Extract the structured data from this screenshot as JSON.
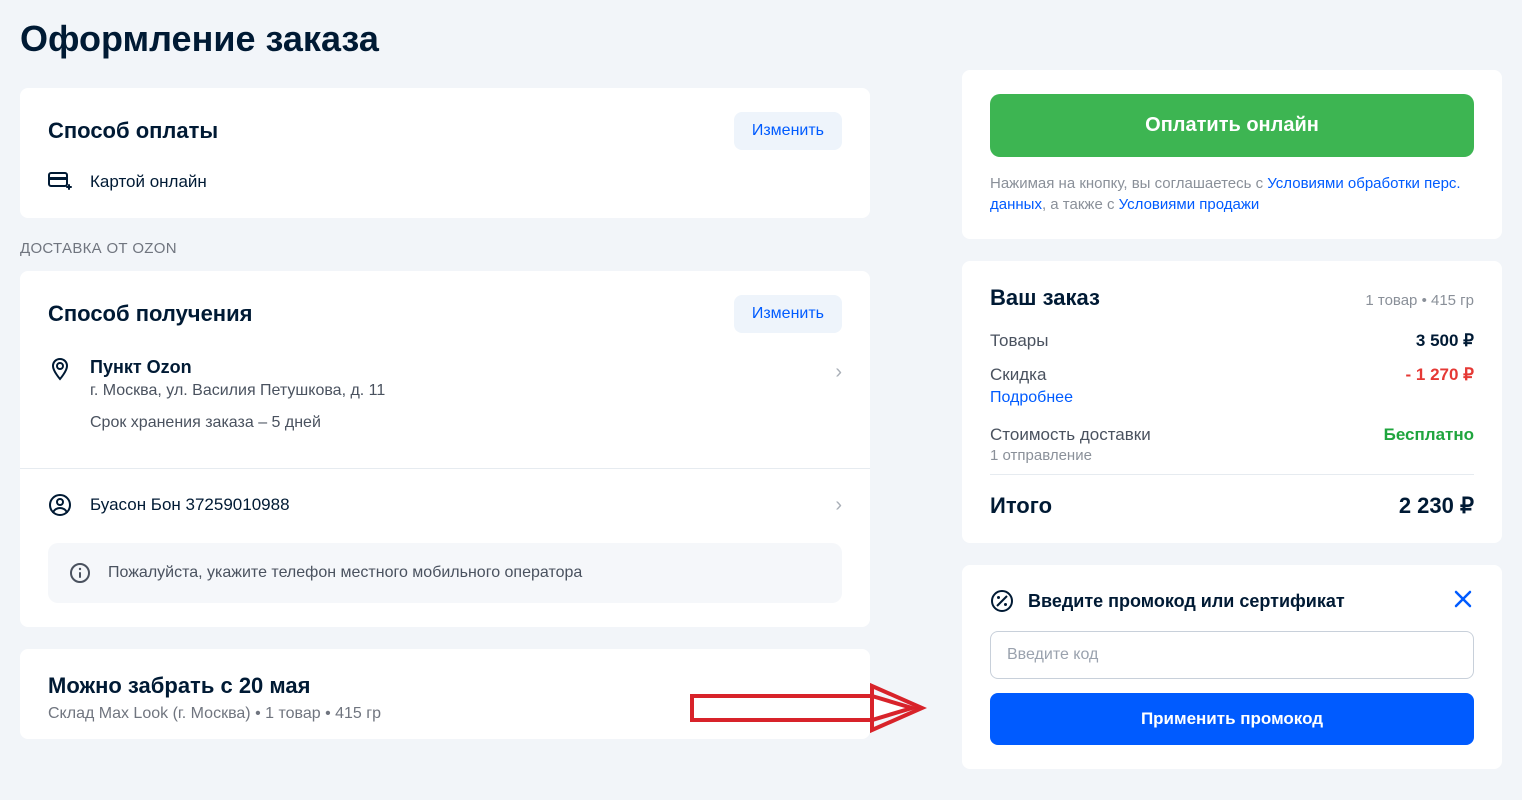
{
  "page": {
    "title": "Оформление заказа"
  },
  "payment": {
    "section_title": "Способ оплаты",
    "change_label": "Изменить",
    "method_label": "Картой онлайн"
  },
  "delivery": {
    "group_label": "ДОСТАВКА ОТ OZON",
    "section_title": "Способ получения",
    "change_label": "Изменить",
    "point_title": "Пункт Ozon",
    "point_address": "г. Москва, ул. Василия Петушкова, д. 11",
    "storage_text": "Срок хранения заказа – 5 дней",
    "recipient": "Буасон Бон 37259010988",
    "phone_warning": "Пожалуйста, укажите телефон местного мобильного оператора"
  },
  "pickup": {
    "title": "Можно забрать с 20 мая",
    "sub": "Склад Max Look (г. Москва) • 1 товар • 415 гр"
  },
  "order": {
    "pay_button": "Оплатить онлайн",
    "agreement_pre": "Нажимая на кнопку, вы соглашаетесь с ",
    "agreement_link1": "Условиями обработки перс. данных",
    "agreement_mid": ", а также с ",
    "agreement_link2": "Условиями продажи",
    "summary_title": "Ваш заказ",
    "summary_meta": "1 товар • 415 гр",
    "items_label": "Товары",
    "items_value": "3 500",
    "discount_label": "Скидка",
    "discount_value": "- 1 270",
    "discount_more": "Подробнее",
    "shipping_label": "Стоимость доставки",
    "shipping_value": "Бесплатно",
    "shipping_sub": "1 отправление",
    "total_label": "Итого",
    "total_value": "2 230"
  },
  "promo": {
    "title": "Введите промокод или сертификат",
    "input_placeholder": "Введите код",
    "apply_label": "Применить промокод"
  }
}
